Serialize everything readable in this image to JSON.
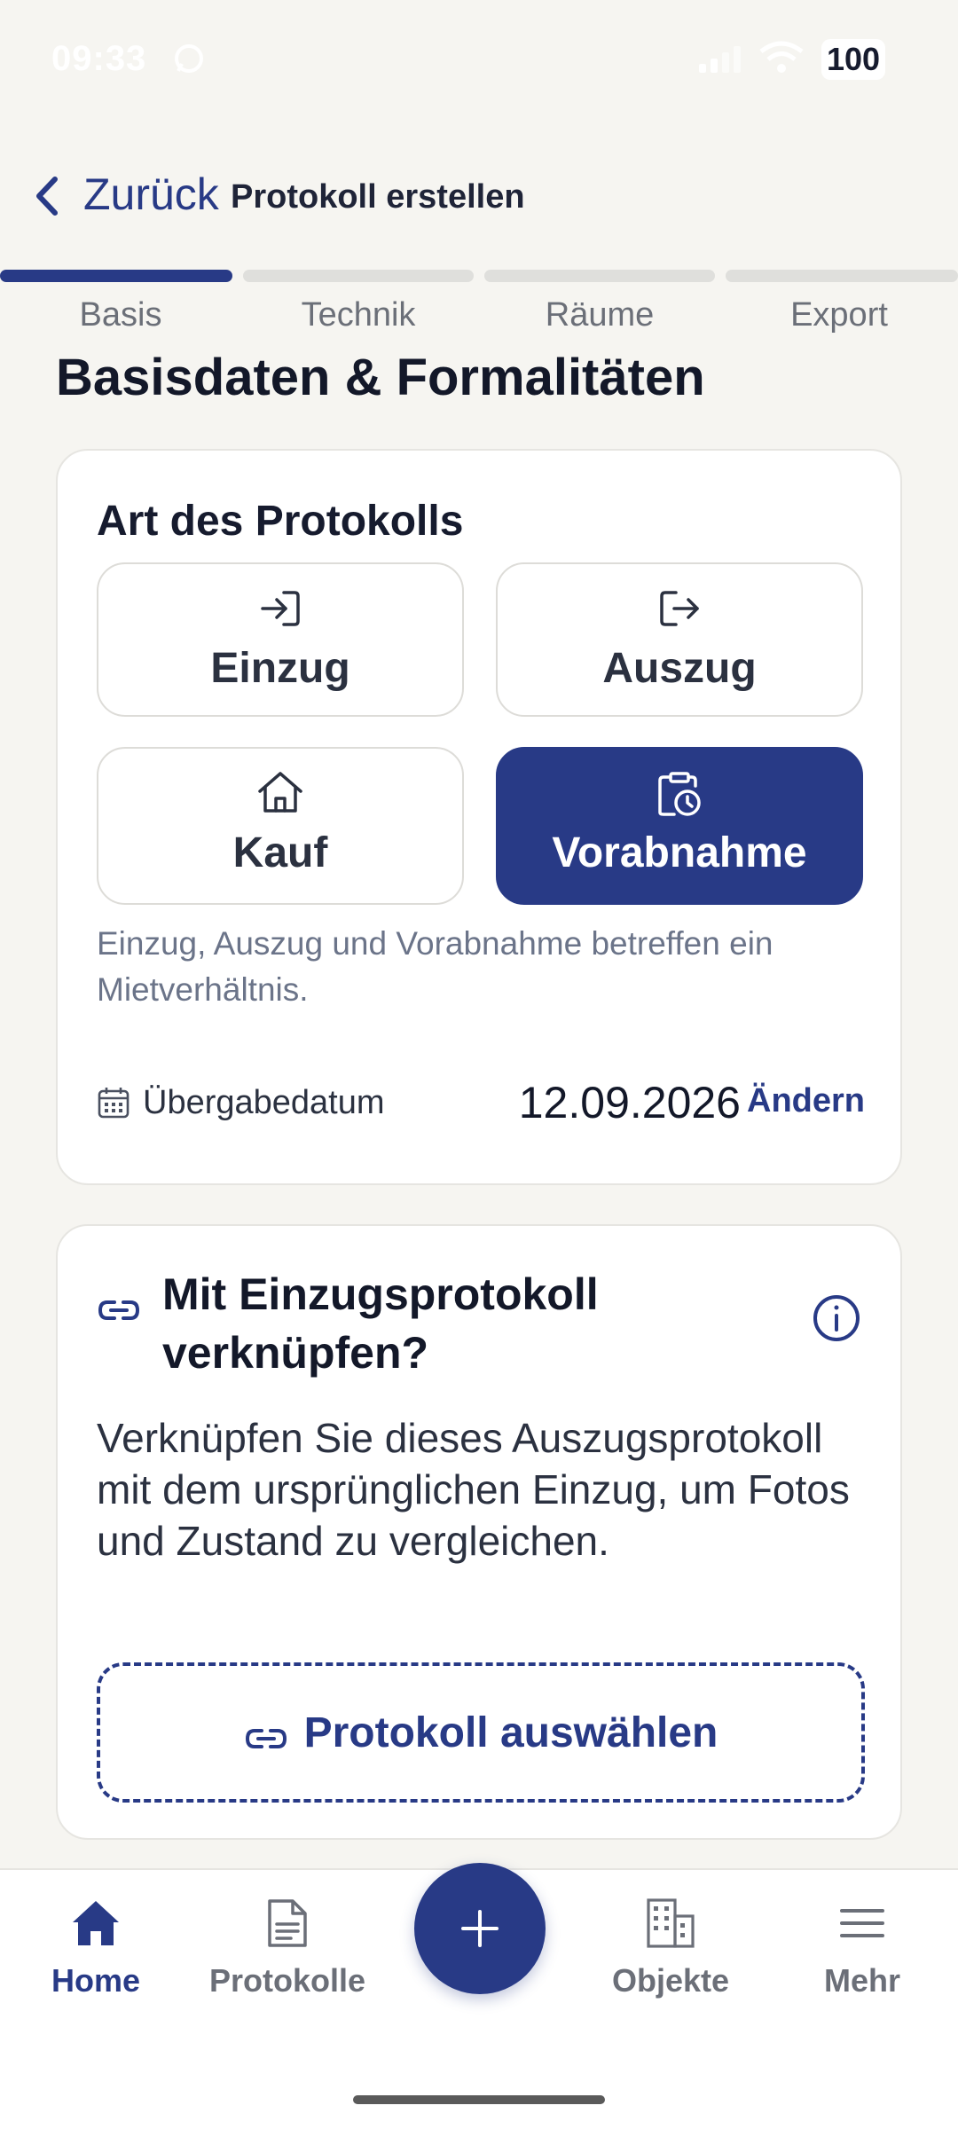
{
  "status_bar": {
    "time": "09:33",
    "battery": "100"
  },
  "header": {
    "back_label": "Zurück",
    "title": "Protokoll erstellen"
  },
  "stepper": {
    "steps": [
      {
        "label": "Basis",
        "active": true
      },
      {
        "label": "Technik",
        "active": false
      },
      {
        "label": "Räume",
        "active": false
      },
      {
        "label": "Export",
        "active": false
      }
    ]
  },
  "page_title": "Basisdaten & Formalitäten",
  "protocol_type": {
    "title": "Art des Protokolls",
    "options": [
      {
        "label": "Einzug",
        "icon": "login-icon",
        "selected": false
      },
      {
        "label": "Auszug",
        "icon": "logout-icon",
        "selected": false
      },
      {
        "label": "Kauf",
        "icon": "house-icon",
        "selected": false
      },
      {
        "label": "Vorabnahme",
        "icon": "clipboard-clock-icon",
        "selected": true
      }
    ],
    "hint": "Einzug, Auszug und Vorabnahme betreffen ein Mietverhältnis.",
    "handover_label": "Übergabedatum",
    "handover_date": "12.09.2026",
    "change_label": "Ändern"
  },
  "link_section": {
    "title": "Mit Einzugsprotokoll verknüpfen?",
    "description": "Verknüpfen Sie dieses Auszugsprotokoll mit dem ursprünglichen Einzug, um Fotos und Zustand zu vergleichen.",
    "button_label": "Protokoll auswählen"
  },
  "bottom_nav": {
    "items": [
      {
        "label": "Home",
        "icon": "home-icon",
        "active": true
      },
      {
        "label": "Protokolle",
        "icon": "document-icon",
        "active": false
      },
      {
        "label": "Objekte",
        "icon": "building-icon",
        "active": false
      },
      {
        "label": "Mehr",
        "icon": "menu-icon",
        "active": false
      }
    ]
  },
  "colors": {
    "primary": "#283a86",
    "background": "#f6f5f1",
    "card": "#ffffff",
    "muted_text": "#6b7489"
  }
}
